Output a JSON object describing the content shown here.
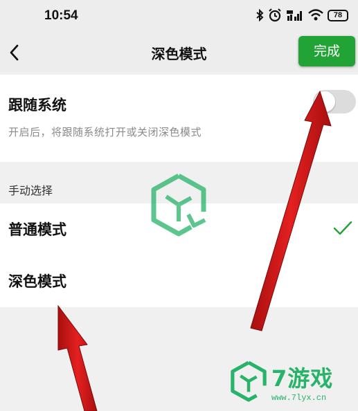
{
  "status_bar": {
    "time": "10:54",
    "battery": "78"
  },
  "nav": {
    "title": "深色模式",
    "done_label": "完成"
  },
  "follow_system": {
    "title": "跟随系统",
    "description": "开启后，将跟随系统打开或关闭深色模式",
    "enabled": false
  },
  "manual_section": {
    "header": "手动选择",
    "options": [
      {
        "label": "普通模式",
        "selected": true
      },
      {
        "label": "深色模式",
        "selected": false
      }
    ]
  },
  "watermark": {
    "brand": "7游戏",
    "url": "www.7lyx.cn"
  },
  "colors": {
    "accent": "#21a336",
    "arrow": "#d81818",
    "watermark": "#27b36a"
  }
}
